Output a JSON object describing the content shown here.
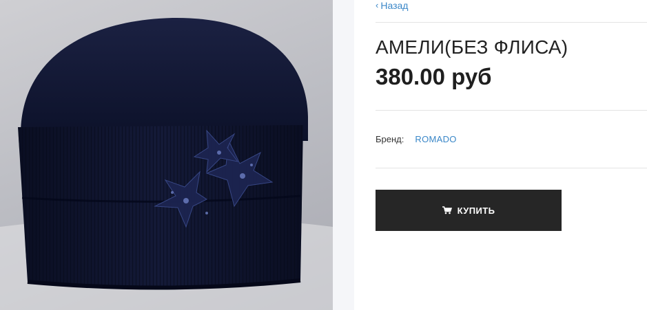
{
  "nav": {
    "back_label": "Назад"
  },
  "product": {
    "title": "АМЕЛИ(БЕЗ ФЛИСА)",
    "price": "380.00 руб",
    "brand_label": "Бренд:",
    "brand_value": "ROMADO"
  },
  "actions": {
    "buy_label": "КУПИТЬ",
    "buy_icon": "cart-icon"
  },
  "photo": {
    "subject": "knit hat",
    "hat_color": "#0f1530",
    "backdrop_color": "#c4c5ca"
  },
  "theme": {
    "link_color": "#3a87c8",
    "button_color": "#262626"
  }
}
